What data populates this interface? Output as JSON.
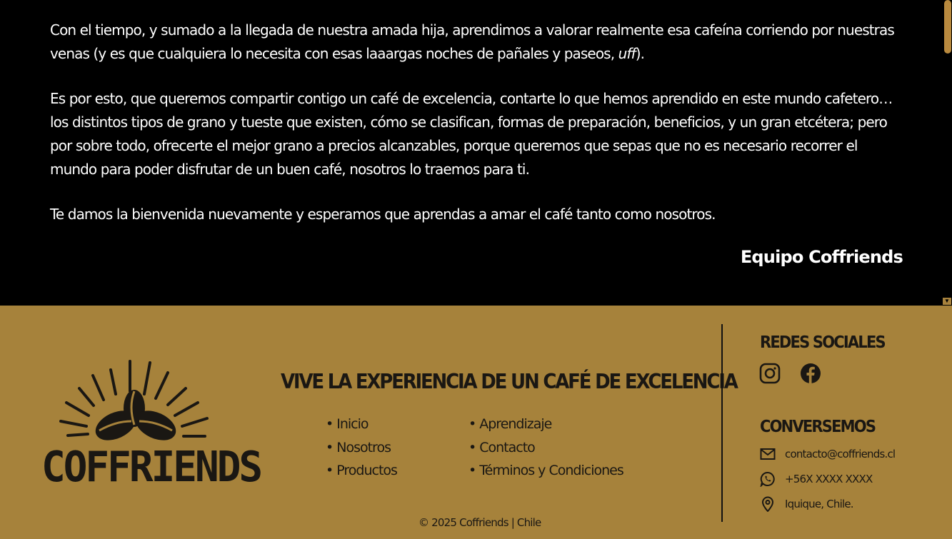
{
  "article": {
    "paragraph_1": "Con el tiempo, y sumado a la llegada de nuestra amada hija, aprendimos a valorar realmente esa cafeína corriendo por nuestras venas (y es que cualquiera lo necesita con esas laaargas noches de pañales y paseos, ",
    "paragraph_1_emphasis": "uff",
    "paragraph_1_end": ").",
    "paragraph_2": "Es por esto, que queremos compartir contigo un café de excelencia, contarte lo que hemos aprendido en este mundo cafetero… los distintos tipos de grano y tueste que existen, cómo se clasifican, formas de preparación, beneficios, y un gran etcétera; pero por sobre todo, ofrecerte el mejor grano a precios alcanzables, porque queremos que sepas que no es necesario recorrer el mundo para poder disfrutar de un buen café, nosotros lo traemos para ti.",
    "paragraph_3": "Te damos la bienvenida nuevamente y esperamos que aprendas a amar el café tanto como nosotros.",
    "signature": "Equipo Coffriends"
  },
  "footer": {
    "brand": "COFFRIENDS",
    "tagline": "VIVE LA EXPERIENCIA DE UN CAFÉ DE EXCELENCIA",
    "nav_col_1": [
      "Inicio",
      "Nosotros",
      "Productos"
    ],
    "nav_col_2": [
      "Aprendizaje",
      "Contacto",
      "Términos y Condiciones"
    ],
    "copyright": "© 2025 Coffriends | Chile",
    "social_heading": "REDES SOCIALES",
    "social_icons": [
      "instagram-icon",
      "facebook-icon"
    ],
    "contact_heading": "CONVERSEMOS",
    "email": "contacto@coffriends.cl",
    "phone": "+56X XXXX XXXX",
    "location": "Iquique, Chile."
  },
  "colors": {
    "background": "#000000",
    "footer": "#a6823b",
    "scrollbar": "#b8893e",
    "text_light": "#ffffff",
    "text_dark": "#1a1713"
  }
}
